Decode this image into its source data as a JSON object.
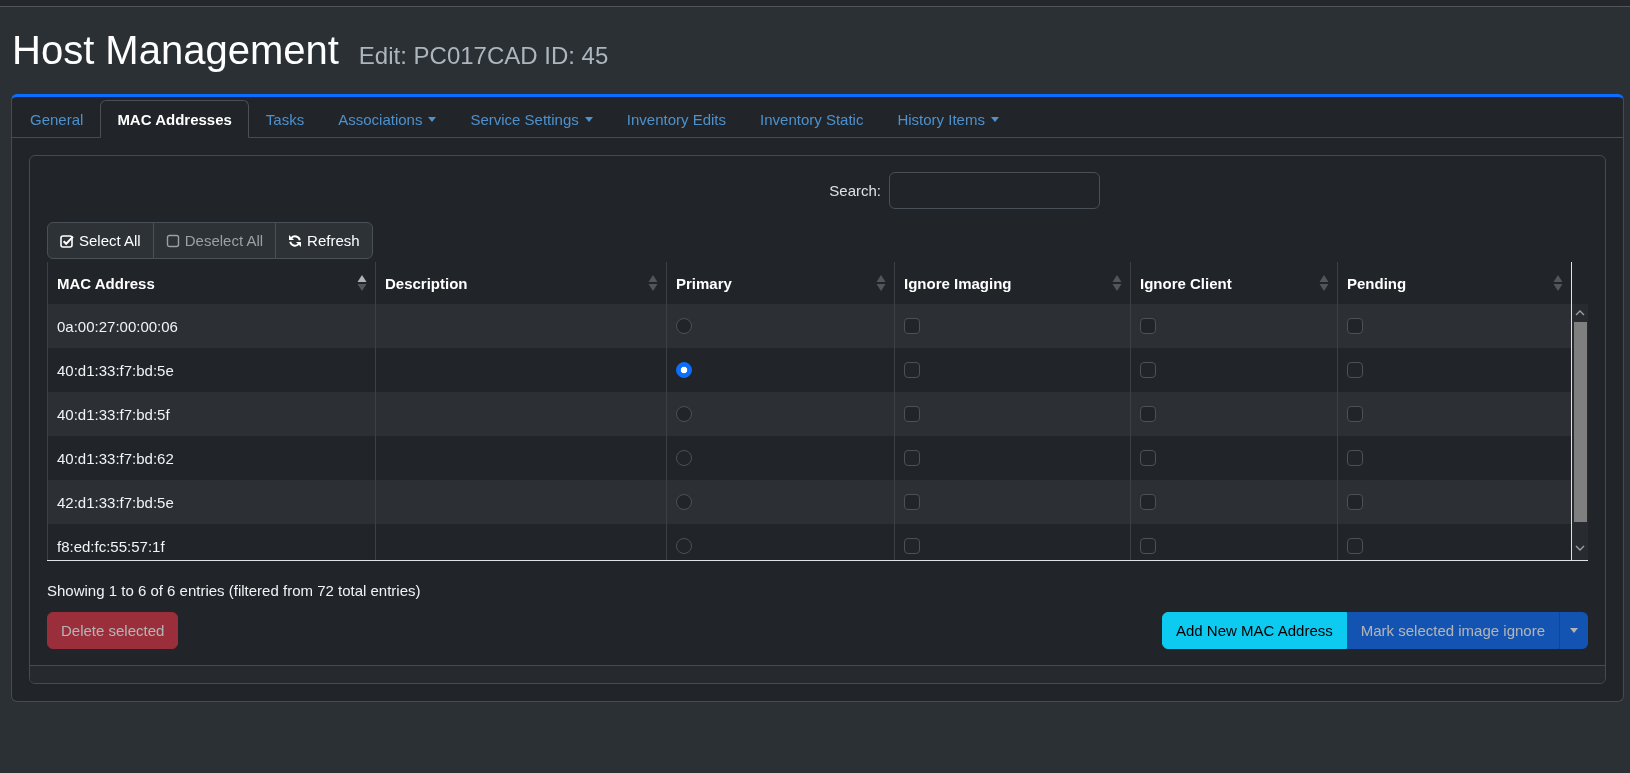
{
  "page": {
    "title": "Host Management",
    "subtitle": "Edit: PC017CAD ID: 45"
  },
  "tabs": [
    {
      "label": "General",
      "selected": false,
      "dropdown": false
    },
    {
      "label": "MAC Addresses",
      "selected": true,
      "dropdown": false
    },
    {
      "label": "Tasks",
      "selected": false,
      "dropdown": false
    },
    {
      "label": "Associations",
      "selected": false,
      "dropdown": true
    },
    {
      "label": "Service Settings",
      "selected": false,
      "dropdown": true
    },
    {
      "label": "Inventory Edits",
      "selected": false,
      "dropdown": false
    },
    {
      "label": "Inventory Static",
      "selected": false,
      "dropdown": false
    },
    {
      "label": "History Items",
      "selected": false,
      "dropdown": true
    }
  ],
  "search": {
    "label": "Search:"
  },
  "toolbar": [
    {
      "kind": "select_all",
      "label": "Select All",
      "disabled": false
    },
    {
      "kind": "deselect_all",
      "label": "Deselect All",
      "disabled": true
    },
    {
      "kind": "refresh",
      "label": "Refresh",
      "disabled": false
    }
  ],
  "table": {
    "columns": [
      {
        "label": "MAC Address",
        "sorted_ascending": true
      },
      {
        "label": "Description",
        "sorted_ascending": false
      },
      {
        "label": "Primary",
        "sorted_ascending": false
      },
      {
        "label": "Ignore Imaging",
        "sorted_ascending": false
      },
      {
        "label": "Ignore Client",
        "sorted_ascending": false
      },
      {
        "label": "Pending",
        "sorted_ascending": false
      }
    ],
    "rows": [
      {
        "mac": "0a:00:27:00:00:06",
        "primary": false,
        "ignore_imaging": false,
        "ignore_client": false,
        "pending": false
      },
      {
        "mac": "40:d1:33:f7:bd:5e",
        "primary": true,
        "ignore_imaging": false,
        "ignore_client": false,
        "pending": false
      },
      {
        "mac": "40:d1:33:f7:bd:5f",
        "primary": false,
        "ignore_imaging": false,
        "ignore_client": false,
        "pending": false
      },
      {
        "mac": "40:d1:33:f7:bd:62",
        "primary": false,
        "ignore_imaging": false,
        "ignore_client": false,
        "pending": false
      },
      {
        "mac": "42:d1:33:f7:bd:5e",
        "primary": false,
        "ignore_imaging": false,
        "ignore_client": false,
        "pending": false
      },
      {
        "mac": "f8:ed:fc:55:57:1f",
        "primary": false,
        "ignore_imaging": false,
        "ignore_client": false,
        "pending": false
      }
    ]
  },
  "info": "Showing 1 to 6 of 6 entries (filtered from 72 total entries)",
  "actions": {
    "left": [
      {
        "kind": "danger",
        "label": "Delete selected",
        "disabled": true,
        "split": false
      }
    ],
    "right": [
      {
        "kind": "info",
        "label": "Add New MAC Address",
        "disabled": false,
        "split": false
      },
      {
        "kind": "primary",
        "label": "Mark selected image ignore",
        "disabled": true,
        "split": true
      }
    ]
  }
}
